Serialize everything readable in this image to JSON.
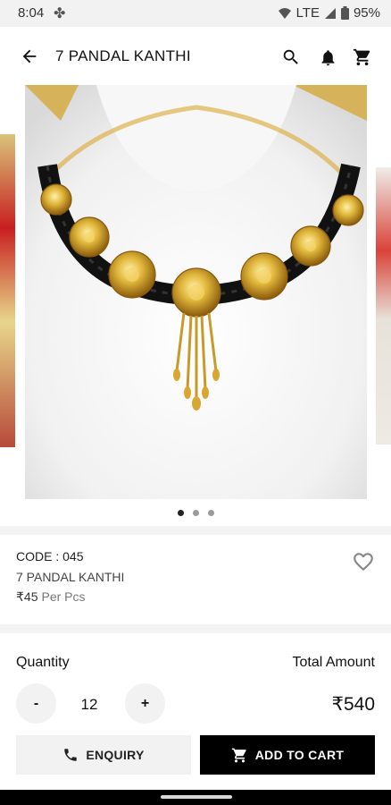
{
  "status_bar": {
    "time": "8:04",
    "network": "LTE",
    "battery": "95%"
  },
  "app_bar": {
    "title": "7 PANDAL KANTHI"
  },
  "product": {
    "code": "CODE : 045",
    "name": "7 PANDAL KANTHI",
    "price": "₹45",
    "price_unit": "Per Pcs"
  },
  "carousel": {
    "total_slides": 3,
    "active_slide": 1
  },
  "quantity": {
    "label": "Quantity",
    "minus": "-",
    "value": "12",
    "plus": "+"
  },
  "total": {
    "label": "Total Amount",
    "value": "₹540"
  },
  "actions": {
    "enquiry": "ENQUIRY",
    "add_to_cart": "ADD TO CART"
  }
}
